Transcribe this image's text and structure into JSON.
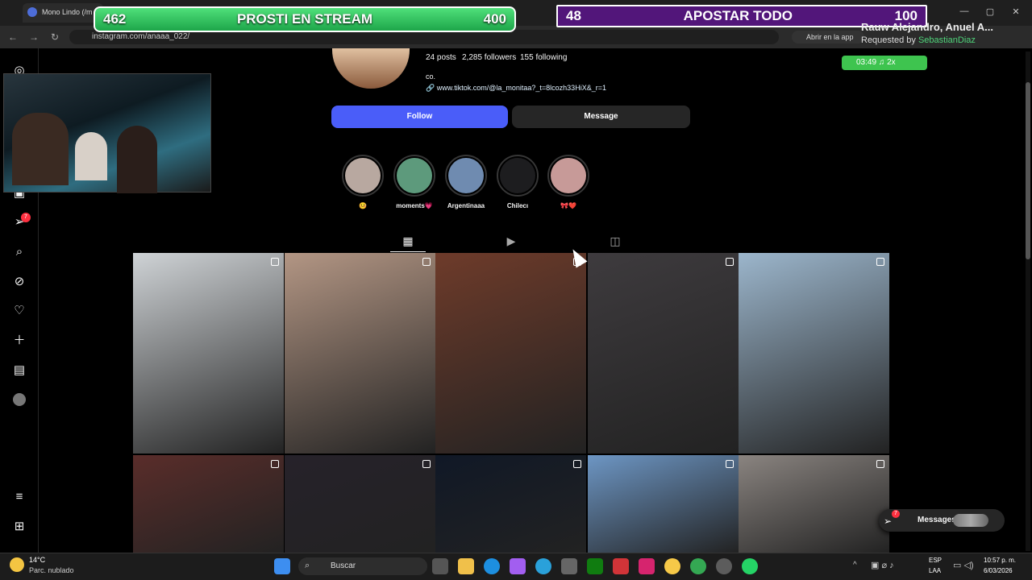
{
  "browser": {
    "tab_title": "Mono Lindo (/m",
    "url": "instagram.com/anaaa_022/"
  },
  "overlay": {
    "bar1": {
      "left": "462",
      "label": "PROSTI EN STREAM",
      "right": "400"
    },
    "bar2": {
      "left": "48",
      "label": "APOSTAR TODO",
      "right": "100"
    },
    "song_title": "Rauw Alejandro, Anuel A...",
    "song_requested_prefix": "Requested by",
    "song_requested_by": "SebastianDiaz",
    "timer": "03:49  ♫ 2x",
    "open_app": "Abrir en la app"
  },
  "profile": {
    "posts": "24 posts",
    "followers": "2,285 followers",
    "following": "155 following",
    "bio": "co.",
    "link": "www.tiktok.com/@la_monitaa?_t=8lcozh33HiX&_r=1",
    "follow_label": "Follow",
    "message_label": "Message",
    "highlights": [
      {
        "label": "🤒",
        "color": "#b8a8a0"
      },
      {
        "label": "moments💗",
        "color": "#5d9a7c"
      },
      {
        "label": "Argentinaaa",
        "color": "#6f8bb0"
      },
      {
        "label": "Chilecı",
        "color": "#1d1d1f"
      },
      {
        "label": "🎀❤️",
        "color": "#c79a98"
      }
    ]
  },
  "grid_colors": [
    "#cfd3d6",
    "#b39684",
    "#6e3b2a",
    "#3e3b3e",
    "#9cb6cc",
    "#5a2d2a",
    "#26222a",
    "#101826",
    "#6d96c4",
    "#8a8480"
  ],
  "messages_label": "Messages",
  "messages_badge": "7",
  "sidebar_badge": "7",
  "taskbar": {
    "temp": "14°C",
    "weather": "Parc. nublado",
    "search": "Buscar",
    "lang1": "ESP",
    "lang2": "LAA",
    "time": "10:57 p. m.",
    "date": "6/03/2026"
  },
  "icons": [
    "instagram-icon",
    "explore-icon",
    "home-icon",
    "search-icon",
    "compass-icon",
    "heart-icon",
    "plus-icon",
    "dashboard-icon",
    "avatar",
    "menu-icon",
    "more-icon"
  ]
}
